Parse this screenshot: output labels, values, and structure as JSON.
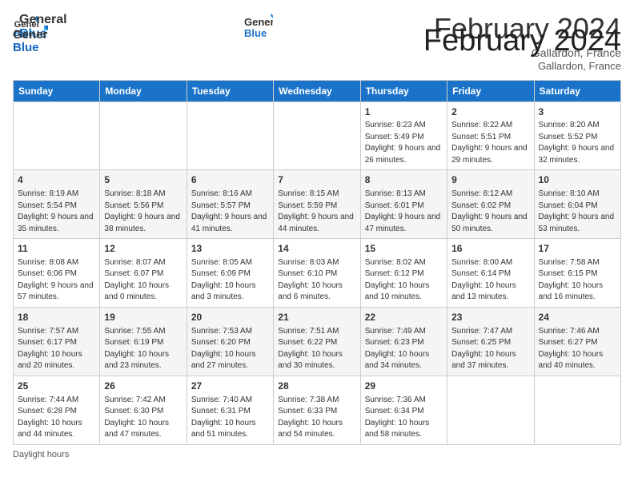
{
  "header": {
    "logo_line1": "General",
    "logo_line2": "Blue",
    "month_title": "February 2024",
    "location": "Gallardon, France"
  },
  "days_of_week": [
    "Sunday",
    "Monday",
    "Tuesday",
    "Wednesday",
    "Thursday",
    "Friday",
    "Saturday"
  ],
  "weeks": [
    [
      {
        "day": "",
        "info": ""
      },
      {
        "day": "",
        "info": ""
      },
      {
        "day": "",
        "info": ""
      },
      {
        "day": "",
        "info": ""
      },
      {
        "day": "1",
        "info": "Sunrise: 8:23 AM\nSunset: 5:49 PM\nDaylight: 9 hours and 26 minutes."
      },
      {
        "day": "2",
        "info": "Sunrise: 8:22 AM\nSunset: 5:51 PM\nDaylight: 9 hours and 29 minutes."
      },
      {
        "day": "3",
        "info": "Sunrise: 8:20 AM\nSunset: 5:52 PM\nDaylight: 9 hours and 32 minutes."
      }
    ],
    [
      {
        "day": "4",
        "info": "Sunrise: 8:19 AM\nSunset: 5:54 PM\nDaylight: 9 hours and 35 minutes."
      },
      {
        "day": "5",
        "info": "Sunrise: 8:18 AM\nSunset: 5:56 PM\nDaylight: 9 hours and 38 minutes."
      },
      {
        "day": "6",
        "info": "Sunrise: 8:16 AM\nSunset: 5:57 PM\nDaylight: 9 hours and 41 minutes."
      },
      {
        "day": "7",
        "info": "Sunrise: 8:15 AM\nSunset: 5:59 PM\nDaylight: 9 hours and 44 minutes."
      },
      {
        "day": "8",
        "info": "Sunrise: 8:13 AM\nSunset: 6:01 PM\nDaylight: 9 hours and 47 minutes."
      },
      {
        "day": "9",
        "info": "Sunrise: 8:12 AM\nSunset: 6:02 PM\nDaylight: 9 hours and 50 minutes."
      },
      {
        "day": "10",
        "info": "Sunrise: 8:10 AM\nSunset: 6:04 PM\nDaylight: 9 hours and 53 minutes."
      }
    ],
    [
      {
        "day": "11",
        "info": "Sunrise: 8:08 AM\nSunset: 6:06 PM\nDaylight: 9 hours and 57 minutes."
      },
      {
        "day": "12",
        "info": "Sunrise: 8:07 AM\nSunset: 6:07 PM\nDaylight: 10 hours and 0 minutes."
      },
      {
        "day": "13",
        "info": "Sunrise: 8:05 AM\nSunset: 6:09 PM\nDaylight: 10 hours and 3 minutes."
      },
      {
        "day": "14",
        "info": "Sunrise: 8:03 AM\nSunset: 6:10 PM\nDaylight: 10 hours and 6 minutes."
      },
      {
        "day": "15",
        "info": "Sunrise: 8:02 AM\nSunset: 6:12 PM\nDaylight: 10 hours and 10 minutes."
      },
      {
        "day": "16",
        "info": "Sunrise: 8:00 AM\nSunset: 6:14 PM\nDaylight: 10 hours and 13 minutes."
      },
      {
        "day": "17",
        "info": "Sunrise: 7:58 AM\nSunset: 6:15 PM\nDaylight: 10 hours and 16 minutes."
      }
    ],
    [
      {
        "day": "18",
        "info": "Sunrise: 7:57 AM\nSunset: 6:17 PM\nDaylight: 10 hours and 20 minutes."
      },
      {
        "day": "19",
        "info": "Sunrise: 7:55 AM\nSunset: 6:19 PM\nDaylight: 10 hours and 23 minutes."
      },
      {
        "day": "20",
        "info": "Sunrise: 7:53 AM\nSunset: 6:20 PM\nDaylight: 10 hours and 27 minutes."
      },
      {
        "day": "21",
        "info": "Sunrise: 7:51 AM\nSunset: 6:22 PM\nDaylight: 10 hours and 30 minutes."
      },
      {
        "day": "22",
        "info": "Sunrise: 7:49 AM\nSunset: 6:23 PM\nDaylight: 10 hours and 34 minutes."
      },
      {
        "day": "23",
        "info": "Sunrise: 7:47 AM\nSunset: 6:25 PM\nDaylight: 10 hours and 37 minutes."
      },
      {
        "day": "24",
        "info": "Sunrise: 7:46 AM\nSunset: 6:27 PM\nDaylight: 10 hours and 40 minutes."
      }
    ],
    [
      {
        "day": "25",
        "info": "Sunrise: 7:44 AM\nSunset: 6:28 PM\nDaylight: 10 hours and 44 minutes."
      },
      {
        "day": "26",
        "info": "Sunrise: 7:42 AM\nSunset: 6:30 PM\nDaylight: 10 hours and 47 minutes."
      },
      {
        "day": "27",
        "info": "Sunrise: 7:40 AM\nSunset: 6:31 PM\nDaylight: 10 hours and 51 minutes."
      },
      {
        "day": "28",
        "info": "Sunrise: 7:38 AM\nSunset: 6:33 PM\nDaylight: 10 hours and 54 minutes."
      },
      {
        "day": "29",
        "info": "Sunrise: 7:36 AM\nSunset: 6:34 PM\nDaylight: 10 hours and 58 minutes."
      },
      {
        "day": "",
        "info": ""
      },
      {
        "day": "",
        "info": ""
      }
    ]
  ],
  "footer": {
    "note": "Daylight hours"
  }
}
